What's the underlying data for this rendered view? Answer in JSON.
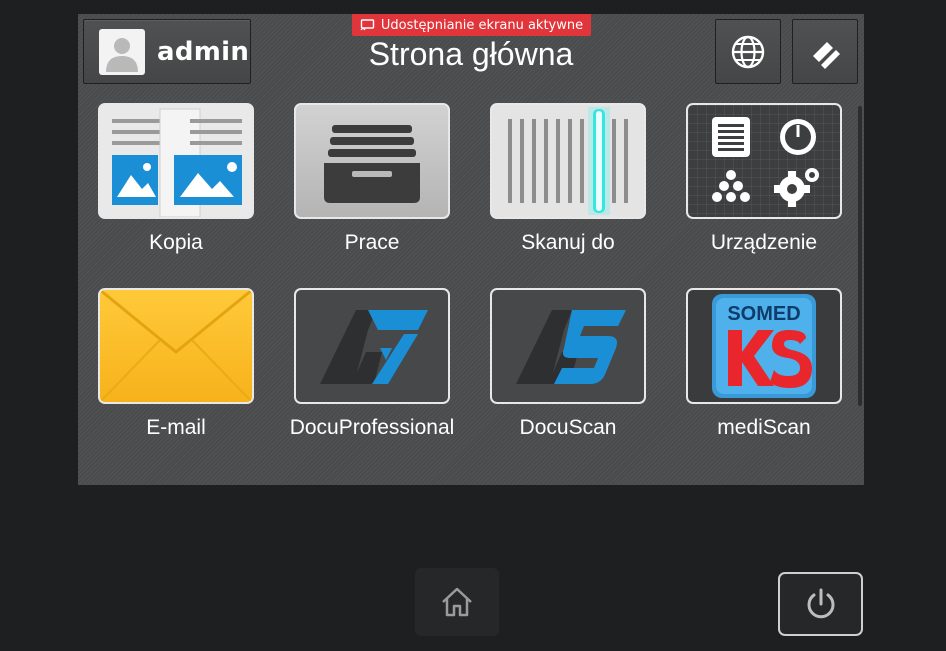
{
  "banner": {
    "text": "Udostępnianie ekranu aktywne",
    "icon": "screen-share-icon"
  },
  "header": {
    "user_name": "admin",
    "title": "Strona główna",
    "language_icon": "globe-icon",
    "edit_icon": "edit-icon"
  },
  "tiles": [
    {
      "label": "Kopia",
      "icon": "copy-icon"
    },
    {
      "label": "Prace",
      "icon": "jobs-icon"
    },
    {
      "label": "Skanuj do",
      "icon": "scan-icon"
    },
    {
      "label": "Urządzenie",
      "icon": "device-icon"
    },
    {
      "label": "E-mail",
      "icon": "email-icon"
    },
    {
      "label": "DocuProfessional",
      "icon": "docuprofessional-icon"
    },
    {
      "label": "DocuScan",
      "icon": "docuscan-icon"
    },
    {
      "label": "mediScan",
      "icon": "mediscan-icon",
      "logo_text": "SOMED"
    }
  ],
  "footer": {
    "home_icon": "home-icon",
    "power_icon": "power-icon"
  },
  "colors": {
    "banner": "#e0353a",
    "panel": "#4a4b4c",
    "background": "#1e1f20",
    "accent_blue": "#1a8fd6"
  }
}
